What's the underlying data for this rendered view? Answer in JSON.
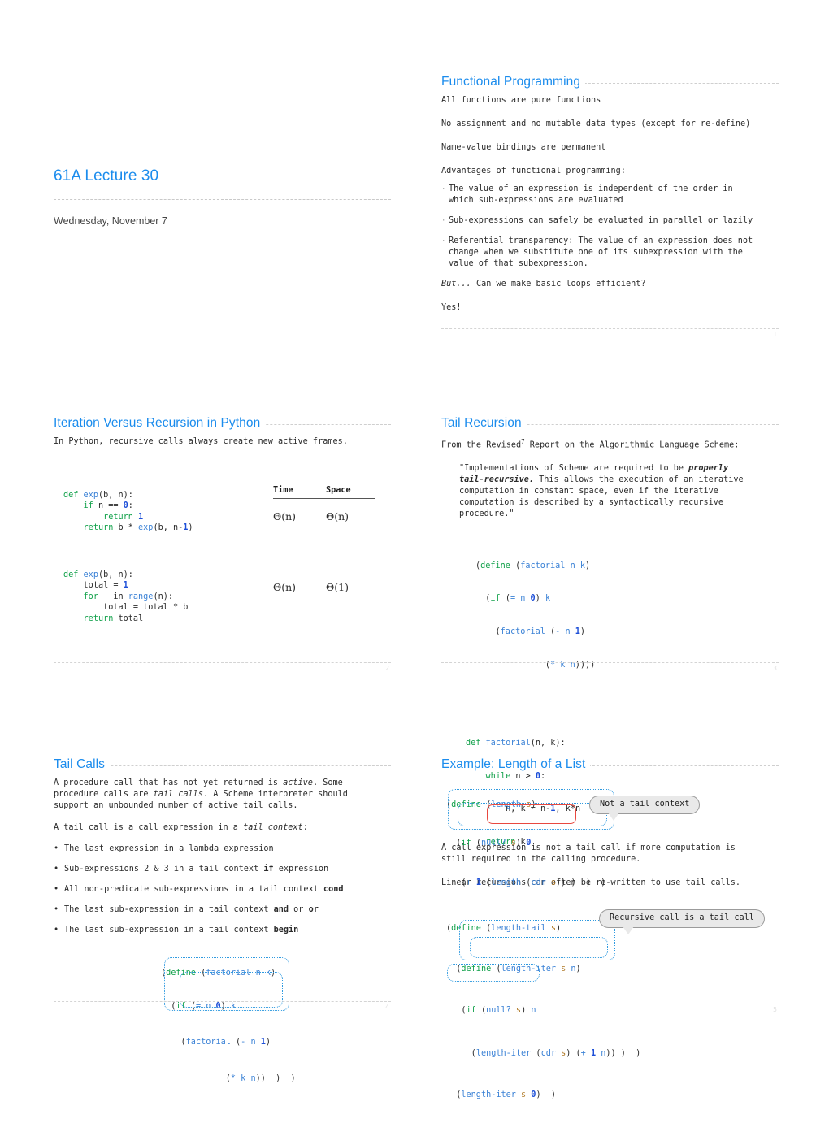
{
  "deck": {
    "title": "61A Lecture 30",
    "date": "Wednesday, November 7"
  },
  "slides": {
    "functional_programming": {
      "title": "Functional Programming",
      "lines": [
        "All functions are pure functions",
        "No assignment and no mutable data types (except for re-define)",
        "Name-value bindings are permanent",
        "Advantages of functional programming:"
      ],
      "bullets": [
        "The value of an expression is independent of the order in\nwhich sub-expressions are evaluated",
        "Sub-expressions can safely be evaluated in parallel or lazily",
        "Referential transparency: The value of an expression does not\nchange when we substitute one of its subexpression with the\nvalue of that subexpression."
      ],
      "but_italic": "But...",
      "but_rest": " Can we make basic loops efficient?",
      "yes": "Yes!",
      "page": "1"
    },
    "iteration_vs_recursion": {
      "title": "Iteration Versus Recursion in Python",
      "intro": "In Python, recursive calls always create new active frames.",
      "table": {
        "headers": [
          "Time",
          "Space"
        ],
        "rows": [
          [
            "Θ(n)",
            "Θ(n)"
          ],
          [
            "Θ(n)",
            "Θ(1)"
          ]
        ]
      },
      "code_recursive": {
        "l1_kw": "def",
        "l1_fn": "exp",
        "l1_rest": "(b, n):",
        "l2_kw": "if",
        "l2_mid": " n == ",
        "l2_num": "0",
        "l2_end": ":",
        "l3_kw": "return",
        "l3_num": "1",
        "l4_kw": "return",
        "l4_rest": " b * ",
        "l4_fn": "exp",
        "l4_args": "(b, n-",
        "l4_num": "1",
        "l4_close": ")"
      },
      "code_iterative": {
        "l1_kw": "def",
        "l1_fn": "exp",
        "l1_rest": "(b, n):",
        "l2_pl": "total = ",
        "l2_num": "1",
        "l3_kw": "for",
        "l3_mid": " _ in ",
        "l3_fn": "range",
        "l3_end": "(n):",
        "l4_pl": "total = total * b",
        "l5_kw": "return",
        "l5_pl": " total"
      },
      "page": "2"
    },
    "tail_recursion": {
      "title": "Tail Recursion",
      "intro_a": "From the Revised",
      "intro_sup": "7",
      "intro_b": " Report on the Algorithmic Language Scheme:",
      "quote_1": "\"Implementations of Scheme are required to be ",
      "quote_bold_1": "properly",
      "quote_bold_2": "tail-recursive.",
      "quote_2": " This allows the execution of an iterative",
      "quote_3": "computation in constant space, even if the iterative",
      "quote_4": "computation is described by a syntactically recursive",
      "quote_5": "procedure.\"",
      "scheme_code": [
        "(define (factorial n k)",
        "  (if (= n 0) k",
        "    (factorial (- n 1)",
        "              (* k n))))"
      ],
      "python_code": [
        "def factorial(n, k):",
        "    while n > 0:",
        "        n, k = n-1, k*n",
        "    return k"
      ],
      "page": "3"
    },
    "tail_calls": {
      "title": "Tail Calls",
      "para1_a": "A procedure call that has not yet returned is ",
      "para1_it1": "active",
      "para1_b": ". Some\nprocedure calls are ",
      "para1_it2": "tail calls",
      "para1_c": ". A Scheme interpreter should\nsupport an unbounded number of active tail calls.",
      "para2_a": "A tail call is a call expression in a ",
      "para2_it": "tail context",
      "para2_b": ":",
      "bullets": [
        {
          "text": "The last expression in a lambda expression",
          "bold": ""
        },
        {
          "text": "Sub-expressions 2 & 3 in a tail context ",
          "bold": "if",
          "after": " expression"
        },
        {
          "text": "All non-predicate sub-expressions in a tail context ",
          "bold": "cond",
          "after": ""
        },
        {
          "text": "The last sub-expression in a tail context ",
          "bold": "and",
          "after": " or ",
          "bold2": "or"
        },
        {
          "text": "The last sub-expression in a tail context ",
          "bold": "begin",
          "after": ""
        }
      ],
      "code": [
        "(define (factorial n k)",
        "  (if (= n 0) k",
        "    (factorial (- n 1)",
        "             (* k n))) )"
      ],
      "page": "4"
    },
    "length_example": {
      "title": "Example: Length of a List",
      "code1_l1": "(define (length s)",
      "code1_l2": "  (if (null? s) 0",
      "code1_l3": "   (+ 1 (length (cdr s)) ) )  )",
      "callout1": "Not a tail context",
      "para1": "A call expression is not a tail call if more computation is\nstill required in the calling procedure.",
      "para2": "Linear recursions can often be re-written to use tail calls.",
      "code2_l1": "(define (length-tail s)",
      "code2_l2": "  (define (length-iter s n)",
      "code2_l3": "   (if (null? s) n",
      "code2_l4": "     (length-iter (cdr s) (+ 1 n)) )  )",
      "code2_l5": "  (length-iter s 0)  )",
      "callout2": "Recursive call is a tail call",
      "page": "5"
    }
  }
}
